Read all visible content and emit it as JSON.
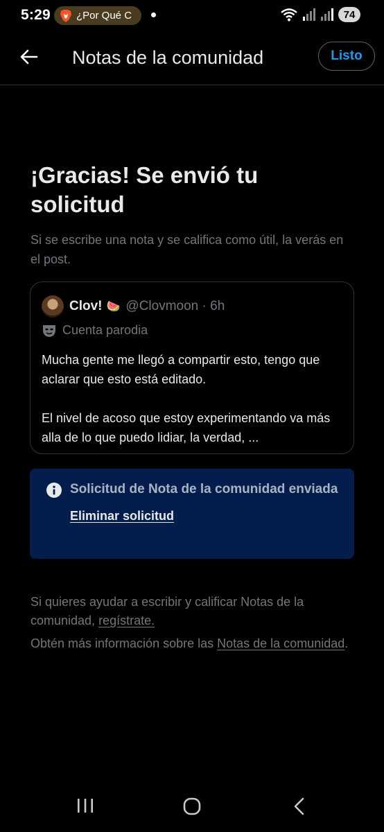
{
  "status_bar": {
    "time": "5:29",
    "notification_text": "¿Por Qué C",
    "battery": "74"
  },
  "header": {
    "title": "Notas de la comunidad",
    "done_label": "Listo"
  },
  "confirmation": {
    "title": "¡Gracias! Se envió tu solicitud",
    "subtitle": "Si se escribe una nota y se califica como útil, la verás en el post."
  },
  "tweet": {
    "display_name": "Clov!",
    "name_emoji": "🍉",
    "handle_time": "@Clovmoon · 6h",
    "account_label": "Cuenta parodia",
    "paragraph1": "Mucha gente me llegó a compartir esto, tengo que aclarar que esto está editado.",
    "paragraph2": "El nivel de acoso que estoy experimentando va más alla de lo que puedo lidiar, la verdad, ..."
  },
  "notice": {
    "title": "Solicitud de Nota de la comunidad enviada",
    "action_label": "Eliminar solicitud",
    "background": "#031e4c"
  },
  "footer": {
    "help_prefix": "Si quieres ayudar a escribir y calificar Notas de la comunidad, ",
    "help_link": "regístrate.",
    "info_prefix": "Obtén más información sobre las ",
    "info_link": "Notas de la comunidad",
    "info_suffix": "."
  },
  "colors": {
    "accent": "#1d9bf0",
    "secondary_text": "#71767b",
    "border": "#2f3336"
  }
}
